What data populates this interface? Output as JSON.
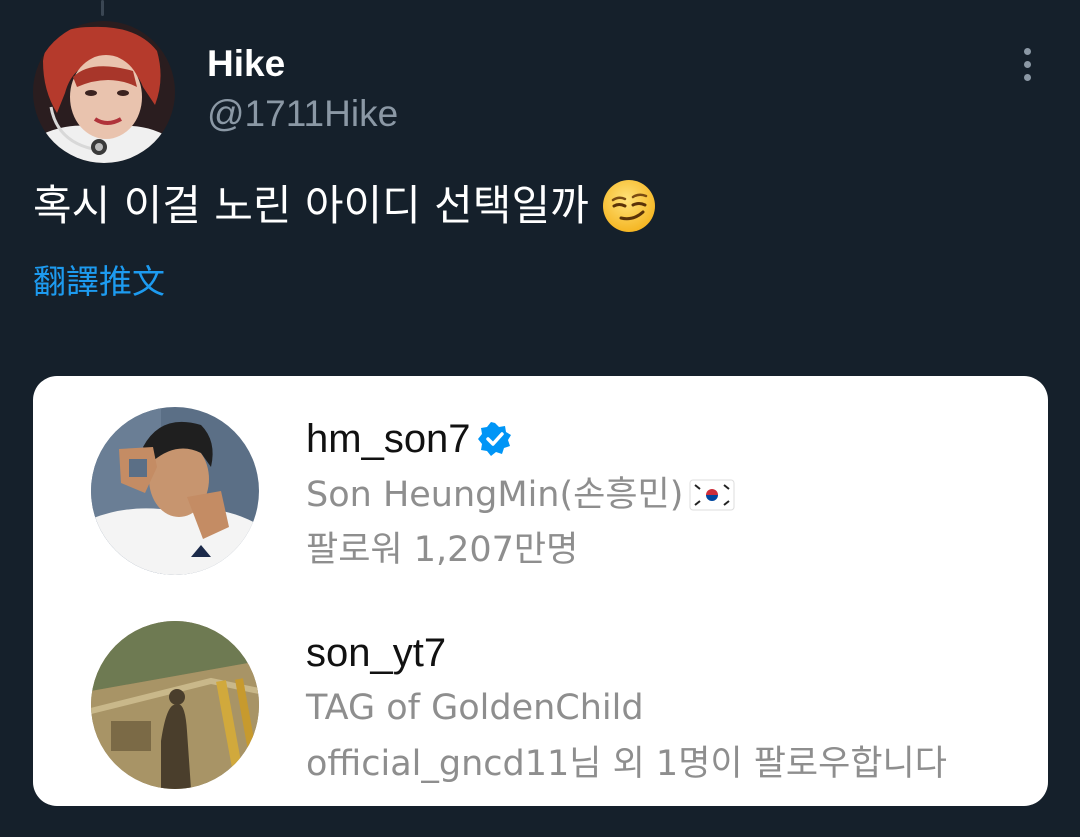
{
  "tweet": {
    "display_name": "Hike",
    "handle": "@1711Hike",
    "text": "혹시 이걸 노린 아이디 선택일까",
    "emoji": "smirking-face-emoji",
    "translate_label": "翻譯推文",
    "more_icon": "more-options-icon"
  },
  "card": {
    "accounts": [
      {
        "username": "hm_son7",
        "verified": true,
        "full_name": "Son HeungMin(손흥민)",
        "flag": "south-korea-flag",
        "meta": "팔로워 1,207만명"
      },
      {
        "username": "son_yt7",
        "verified": false,
        "full_name": "TAG of GoldenChild",
        "meta": "official_gncd11님 외 1명이 팔로우합니다"
      }
    ]
  },
  "colors": {
    "background": "#15202b",
    "link": "#1d9bf0",
    "verified": "#0095f6",
    "secondary_text": "#8b98a5"
  }
}
